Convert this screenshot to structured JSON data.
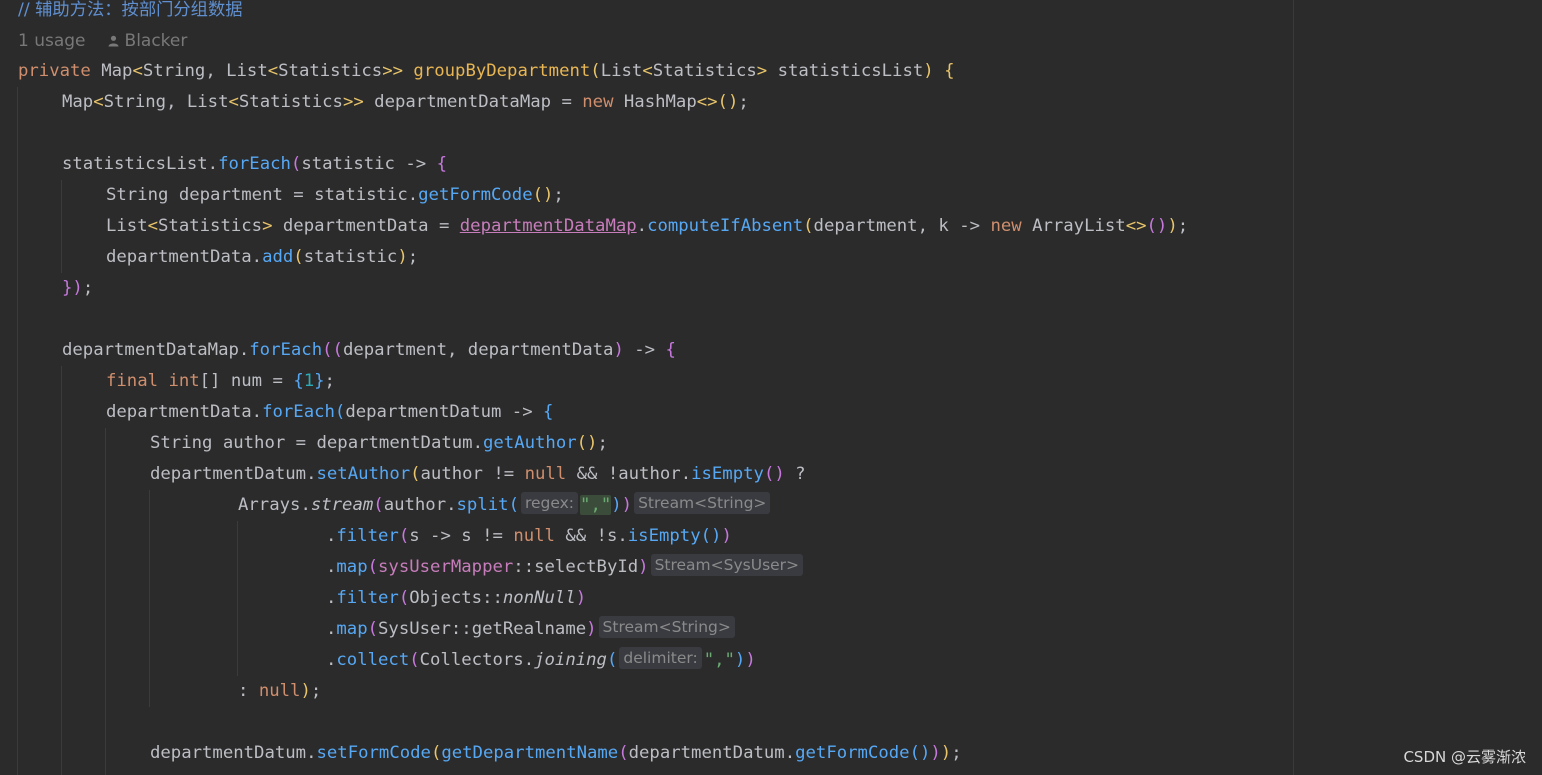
{
  "comment": "// 辅助方法：按部门分组数据",
  "meta": {
    "usage": "1 usage",
    "author": "Blacker"
  },
  "code": {
    "l1": {
      "private": "private",
      "Map": "Map",
      "String": "String",
      "List": "List",
      "Statistics": "Statistics",
      "groupByDepartment": "groupByDepartment",
      "List2": "List",
      "Statistics2": "Statistics",
      "statisticsList": "statisticsList"
    },
    "l2": {
      "Map": "Map",
      "String": "String",
      "List": "List",
      "Statistics": "Statistics",
      "departmentDataMap": "departmentDataMap",
      "new": "new",
      "HashMap": "HashMap"
    },
    "l3": {
      "statisticsList": "statisticsList",
      "forEach": "forEach",
      "statistic": "statistic"
    },
    "l4": {
      "String": "String",
      "department": "department",
      "statistic": "statistic",
      "getFormCode": "getFormCode"
    },
    "l5": {
      "List": "List",
      "Statistics": "Statistics",
      "departmentData": "departmentData",
      "departmentDataMap": "departmentDataMap",
      "computeIfAbsent": "computeIfAbsent",
      "department": "department",
      "k": "k",
      "new": "new",
      "ArrayList": "ArrayList"
    },
    "l6": {
      "departmentData": "departmentData",
      "add": "add",
      "statistic": "statistic"
    },
    "l8": {
      "departmentDataMap": "departmentDataMap",
      "forEach": "forEach",
      "department": "department",
      "departmentData": "departmentData"
    },
    "l9": {
      "final": "final",
      "int": "int",
      "num": "num",
      "one": "1"
    },
    "l10": {
      "departmentData": "departmentData",
      "forEach": "forEach",
      "departmentDatum": "departmentDatum"
    },
    "l11": {
      "String": "String",
      "author": "author",
      "departmentDatum": "departmentDatum",
      "getAuthor": "getAuthor"
    },
    "l12": {
      "departmentDatum": "departmentDatum",
      "setAuthor": "setAuthor",
      "author": "author",
      "null": "null",
      "author2": "author",
      "isEmpty": "isEmpty"
    },
    "l13": {
      "Arrays": "Arrays",
      "stream": "stream",
      "author": "author",
      "split": "split",
      "hint": "regex:",
      "comma": "\",\"",
      "typehint": "Stream<String>"
    },
    "l14": {
      "filter": "filter",
      "s": "s",
      "s2": "s",
      "null": "null",
      "s3": "s",
      "isEmpty": "isEmpty"
    },
    "l15": {
      "map": "map",
      "sysUserMapper": "sysUserMapper",
      "selectById": "selectById",
      "typehint": "Stream<SysUser>"
    },
    "l16": {
      "filter": "filter",
      "Objects": "Objects",
      "nonNull": "nonNull"
    },
    "l17": {
      "map": "map",
      "SysUser": "SysUser",
      "getRealname": "getRealname",
      "typehint": "Stream<String>"
    },
    "l18": {
      "collect": "collect",
      "Collectors": "Collectors",
      "joining": "joining",
      "hint": "delimiter:",
      "comma": "\",\""
    },
    "l19": {
      "null": "null"
    },
    "l21": {
      "departmentDatum": "departmentDatum",
      "setFormCode": "setFormCode",
      "getDepartmentName": "getDepartmentName",
      "departmentDatum2": "departmentDatum",
      "getFormCode": "getFormCode"
    }
  },
  "watermark": "CSDN @云雾渐浓"
}
